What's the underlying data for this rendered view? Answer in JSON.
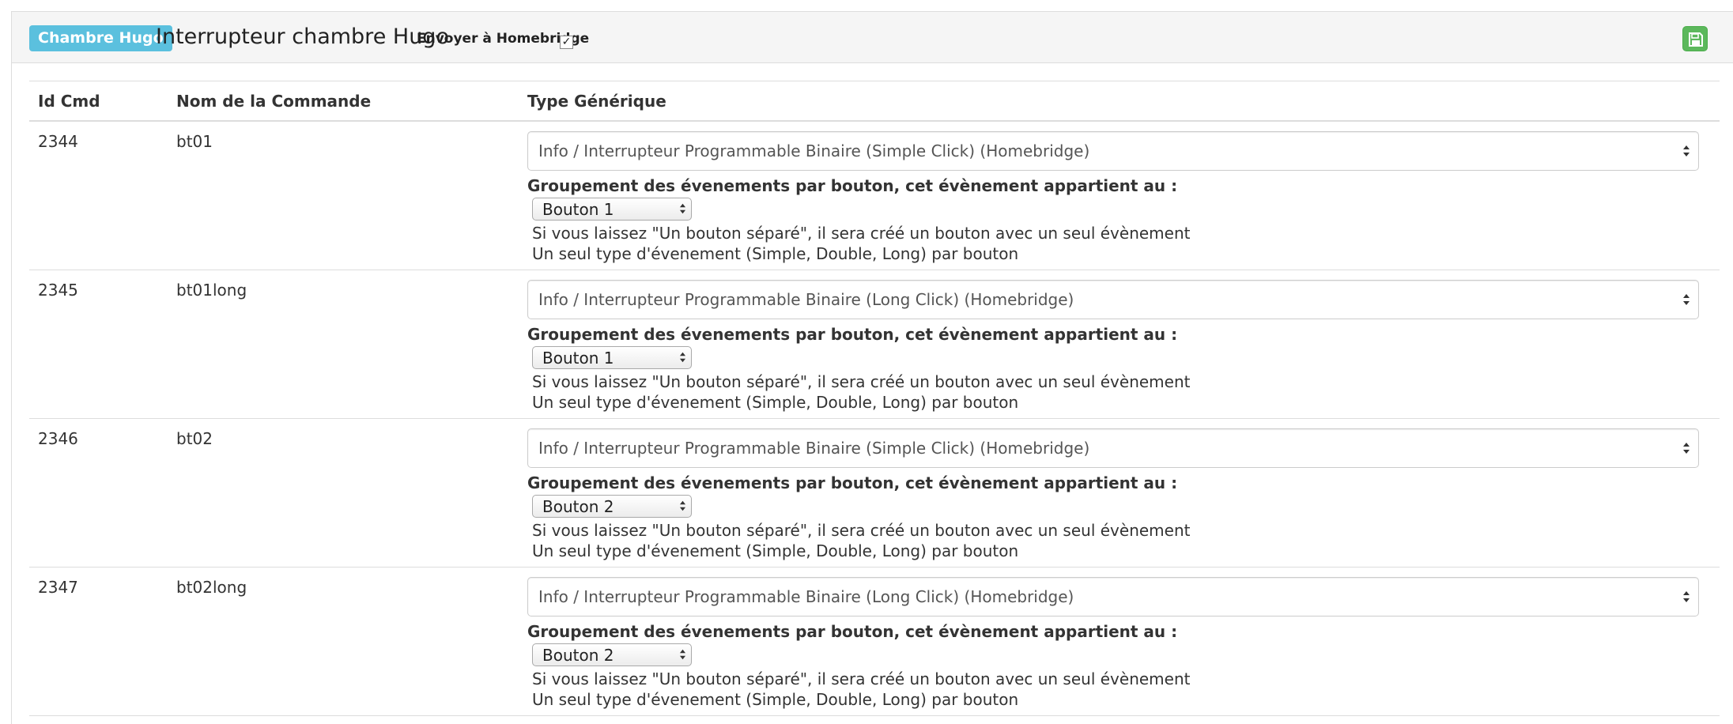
{
  "header": {
    "object_badge": "Chambre Hugo",
    "device_name": "Interrupteur chambre Hugo",
    "homebridge_label": "Envoyer à Homebridge",
    "homebridge_checked": true,
    "save_icon": "floppy-disk-icon",
    "save_color": "#5cb85c",
    "badge_color": "#5bc0de"
  },
  "table": {
    "columns": [
      "Id Cmd",
      "Nom de la Commande",
      "Type Générique"
    ],
    "rows": [
      {
        "id": "2344",
        "name": "bt01",
        "generic_type": "Info / Interrupteur Programmable Binaire (Simple Click) (Homebridge)",
        "group_label": "Groupement des évenements par bouton, cet évènement appartient au :",
        "button": "Bouton 1",
        "help_line_1": "Si vous laissez \"Un bouton séparé\", il sera créé un bouton avec un seul évènement",
        "help_line_2": "Un seul type d'évenement (Simple, Double, Long) par bouton"
      },
      {
        "id": "2345",
        "name": "bt01long",
        "generic_type": "Info / Interrupteur Programmable Binaire (Long Click) (Homebridge)",
        "group_label": "Groupement des évenements par bouton, cet évènement appartient au :",
        "button": "Bouton 1",
        "help_line_1": "Si vous laissez \"Un bouton séparé\", il sera créé un bouton avec un seul évènement",
        "help_line_2": "Un seul type d'évenement (Simple, Double, Long) par bouton"
      },
      {
        "id": "2346",
        "name": "bt02",
        "generic_type": "Info / Interrupteur Programmable Binaire (Simple Click) (Homebridge)",
        "group_label": "Groupement des évenements par bouton, cet évènement appartient au :",
        "button": "Bouton 2",
        "help_line_1": "Si vous laissez \"Un bouton séparé\", il sera créé un bouton avec un seul évènement",
        "help_line_2": "Un seul type d'évenement (Simple, Double, Long) par bouton"
      },
      {
        "id": "2347",
        "name": "bt02long",
        "generic_type": "Info / Interrupteur Programmable Binaire (Long Click) (Homebridge)",
        "group_label": "Groupement des évenements par bouton, cet évènement appartient au :",
        "button": "Bouton 2",
        "help_line_1": "Si vous laissez \"Un bouton séparé\", il sera créé un bouton avec un seul évènement",
        "help_line_2": "Un seul type d'évenement (Simple, Double, Long) par bouton"
      }
    ]
  }
}
